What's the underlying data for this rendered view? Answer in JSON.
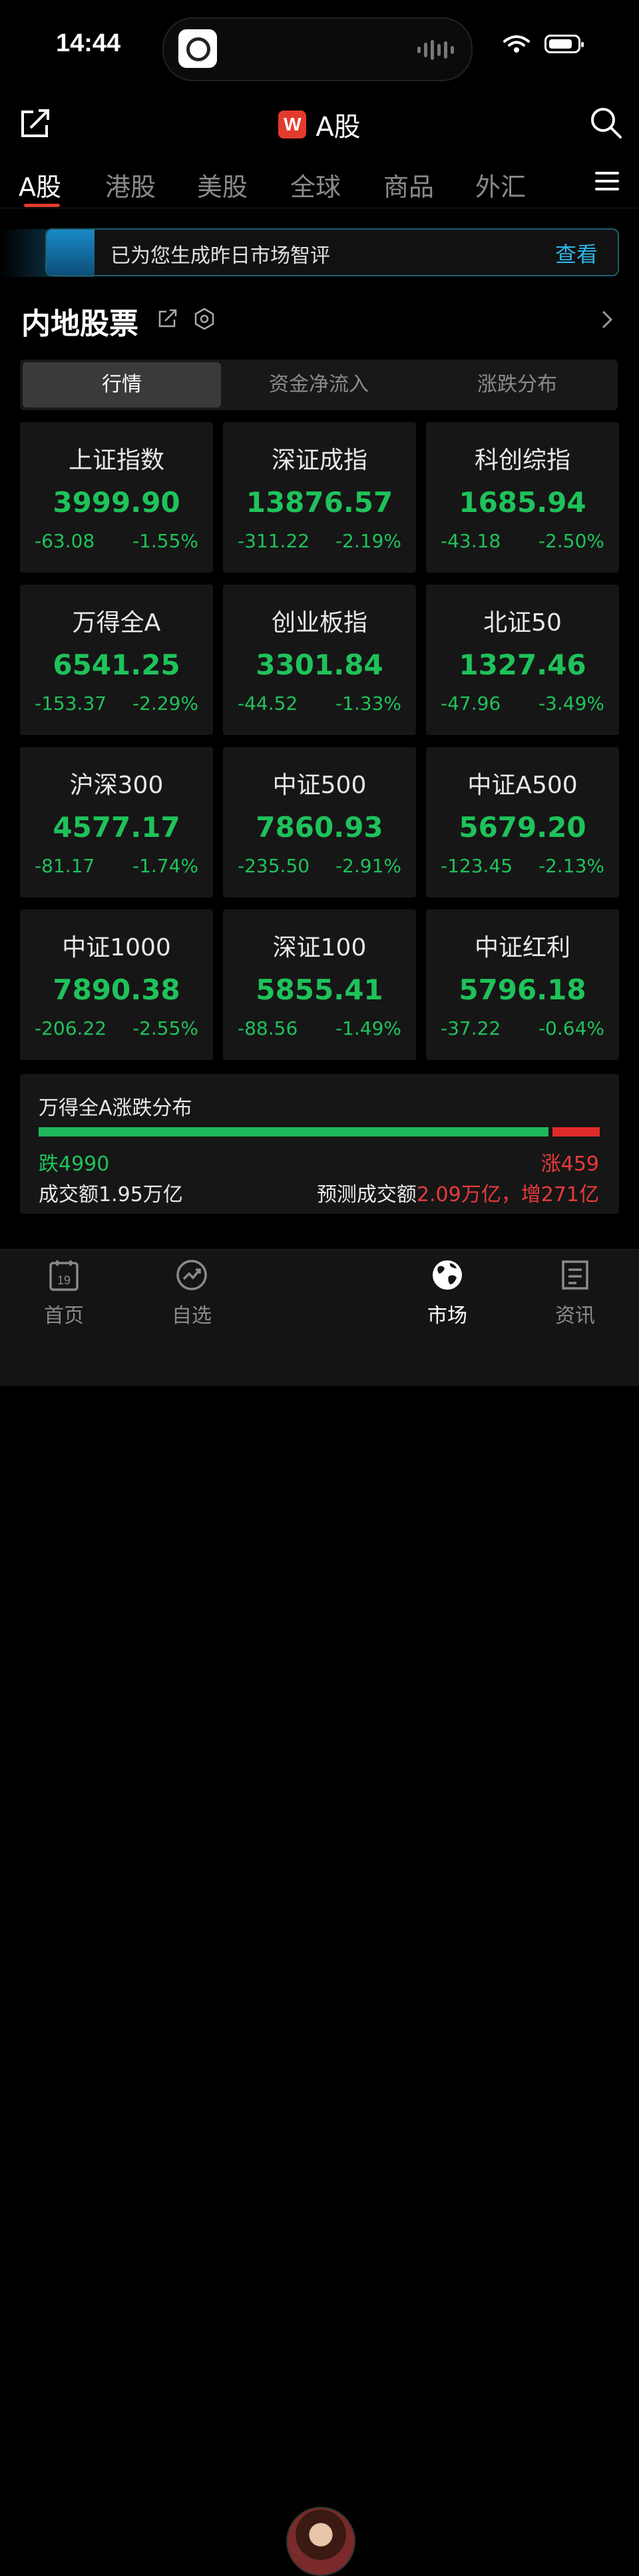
{
  "status_bar": {
    "time": "14:44"
  },
  "header": {
    "logo_letter": "W",
    "title": "A股"
  },
  "tabs": [
    {
      "label": "A股",
      "active": true
    },
    {
      "label": "港股"
    },
    {
      "label": "美股"
    },
    {
      "label": "全球"
    },
    {
      "label": "商品"
    },
    {
      "label": "外汇"
    }
  ],
  "banner": {
    "text": "已为您生成昨日市场智评",
    "link": "查看"
  },
  "section": {
    "title": "内地股票"
  },
  "segments": [
    {
      "label": "行情",
      "active": true
    },
    {
      "label": "资金净流入"
    },
    {
      "label": "涨跌分布"
    }
  ],
  "indices": [
    {
      "name": "上证指数",
      "price": "3999.90",
      "change": "-63.08",
      "pct": "-1.55%"
    },
    {
      "name": "深证成指",
      "price": "13876.57",
      "change": "-311.22",
      "pct": "-2.19%"
    },
    {
      "name": "科创综指",
      "price": "1685.94",
      "change": "-43.18",
      "pct": "-2.50%"
    },
    {
      "name": "万得全A",
      "price": "6541.25",
      "change": "-153.37",
      "pct": "-2.29%"
    },
    {
      "name": "创业板指",
      "price": "3301.84",
      "change": "-44.52",
      "pct": "-1.33%"
    },
    {
      "name": "北证50",
      "price": "1327.46",
      "change": "-47.96",
      "pct": "-3.49%"
    },
    {
      "name": "沪深300",
      "price": "4577.17",
      "change": "-81.17",
      "pct": "-1.74%"
    },
    {
      "name": "中证500",
      "price": "7860.93",
      "change": "-235.50",
      "pct": "-2.91%"
    },
    {
      "name": "中证A500",
      "price": "5679.20",
      "change": "-123.45",
      "pct": "-2.13%"
    },
    {
      "name": "中证1000",
      "price": "7890.38",
      "change": "-206.22",
      "pct": "-2.55%"
    },
    {
      "name": "深证100",
      "price": "5855.41",
      "change": "-88.56",
      "pct": "-1.49%"
    },
    {
      "name": "中证红利",
      "price": "5796.18",
      "change": "-37.22",
      "pct": "-0.64%"
    }
  ],
  "distribution": {
    "title": "万得全A涨跌分布",
    "down_label": "跌4990",
    "up_label": "涨459",
    "down_count": 4990,
    "up_count": 459,
    "turnover": "成交额1.95万亿",
    "forecast_prefix": "预测成交额",
    "forecast_value": "2.09万亿，增271亿"
  },
  "bottom_nav": [
    {
      "label": "首页",
      "icon": "calendar-icon",
      "badge": "19"
    },
    {
      "label": "自选",
      "icon": "trend-icon"
    },
    {
      "label": "市场",
      "icon": "globe-icon",
      "active": true
    },
    {
      "label": "资讯",
      "icon": "news-icon"
    }
  ],
  "colors": {
    "down": "#1fc25a",
    "up": "#e83a3a",
    "accent": "#e23b2e",
    "link": "#2fb4e6"
  }
}
